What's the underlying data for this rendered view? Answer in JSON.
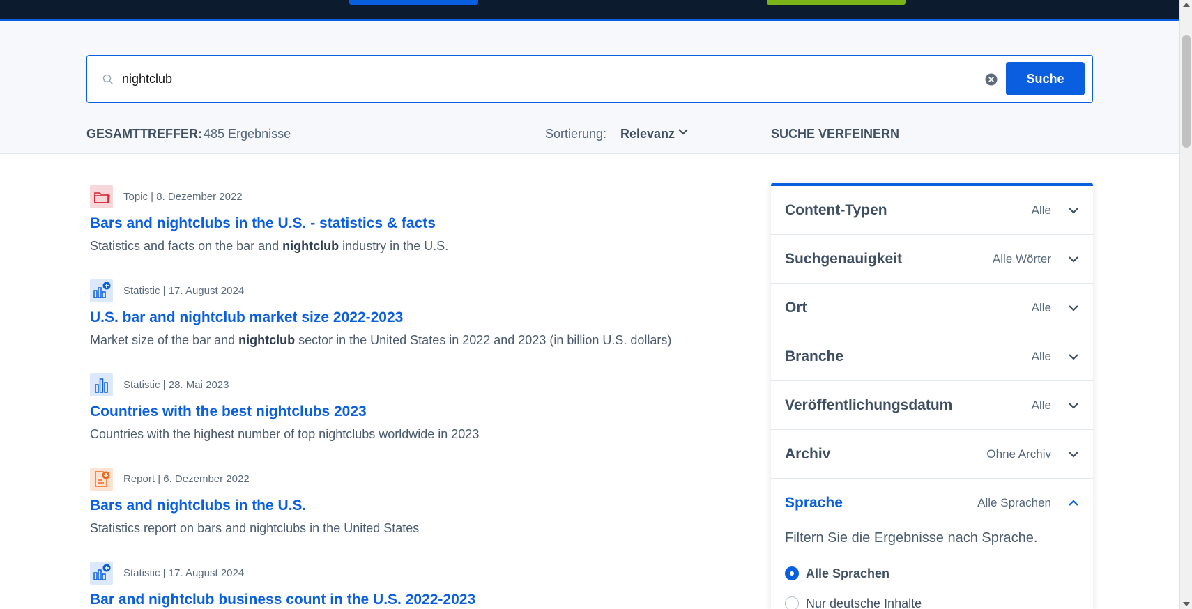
{
  "search": {
    "query": "nightclub",
    "button_label": "Suche"
  },
  "summary": {
    "total_label": "GESAMTTREFFER:",
    "total_value": "485 Ergebnisse",
    "sort_label": "Sortierung:",
    "sort_value": "Relevanz",
    "refine_label": "SUCHE VERFEINERN"
  },
  "results": [
    {
      "icon": "folder-icon",
      "meta": "Topic | 8. Dezember 2022",
      "title": "Bars and nightclubs in the U.S. - statistics & facts",
      "desc_before": "Statistics and facts on the bar and ",
      "desc_bold": "nightclub",
      "desc_after": " industry in the U.S."
    },
    {
      "icon": "statistic-plus-icon",
      "meta": "Statistic | 17. August 2024",
      "title": "U.S. bar and nightclub market size 2022-2023",
      "desc_before": "Market size of the bar and ",
      "desc_bold": "nightclub",
      "desc_after": " sector in the United States in 2022 and 2023 (in billion U.S. dollars)"
    },
    {
      "icon": "bar-chart-icon",
      "meta": "Statistic | 28. Mai 2023",
      "title": "Countries with the best nightclubs 2023",
      "desc_before": "Countries with the highest number of top nightclubs worldwide in 2023",
      "desc_bold": "",
      "desc_after": ""
    },
    {
      "icon": "report-icon",
      "meta": "Report | 6. Dezember 2022",
      "title": "Bars and nightclubs in the U.S.",
      "desc_before": "Statistics report on bars and nightclubs in the United States",
      "desc_bold": "",
      "desc_after": ""
    },
    {
      "icon": "statistic-plus-icon",
      "meta": "Statistic | 17. August 2024",
      "title": "Bar and nightclub business count in the U.S. 2022-2023",
      "desc_before": "",
      "desc_bold": "",
      "desc_after": ""
    }
  ],
  "filters": [
    {
      "name": "Content-Typen",
      "value": "Alle"
    },
    {
      "name": "Suchgenauigkeit",
      "value": "Alle Wörter"
    },
    {
      "name": "Ort",
      "value": "Alle"
    },
    {
      "name": "Branche",
      "value": "Alle"
    },
    {
      "name": "Veröffentlichungsdatum",
      "value": "Alle"
    },
    {
      "name": "Archiv",
      "value": "Ohne Archiv"
    },
    {
      "name": "Sprache",
      "value": "Alle Sprachen"
    }
  ],
  "language": {
    "description": "Filtern Sie die Ergebnisse nach Sprache.",
    "options": [
      {
        "label": "Alle Sprachen",
        "selected": true
      },
      {
        "label": "Nur deutsche Inhalte",
        "selected": false
      }
    ]
  },
  "colors": {
    "accent": "#0a5fe0",
    "topbar": "#0d1b2e",
    "promo_green": "#7ab317"
  }
}
